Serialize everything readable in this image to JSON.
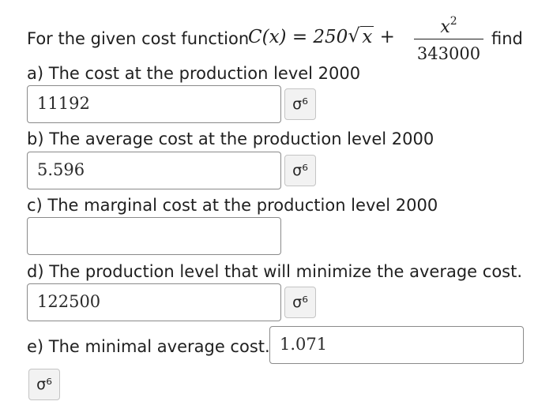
{
  "intro": {
    "prefix": "For the given cost function",
    "function_lhs": "C(x) = 250",
    "sqrt_arg": "x",
    "plus": "+",
    "fraction_numerator_base": "x",
    "fraction_numerator_exponent": "2",
    "fraction_denominator": "343000",
    "suffix": "find"
  },
  "questions": [
    {
      "label": "a) The cost at the production level 2000",
      "answer": "11192"
    },
    {
      "label": "b) The average cost at the production level 2000",
      "answer": "5.596"
    },
    {
      "label": "c) The marginal cost at the production level 2000",
      "answer": ""
    },
    {
      "label": "d) The production level that will minimize the average cost.",
      "answer": "122500"
    },
    {
      "label": "e) The minimal average cost.",
      "answer": "1.071"
    }
  ],
  "tool_icon": "preview-key-icon",
  "tool_glyph": "σ⁶"
}
